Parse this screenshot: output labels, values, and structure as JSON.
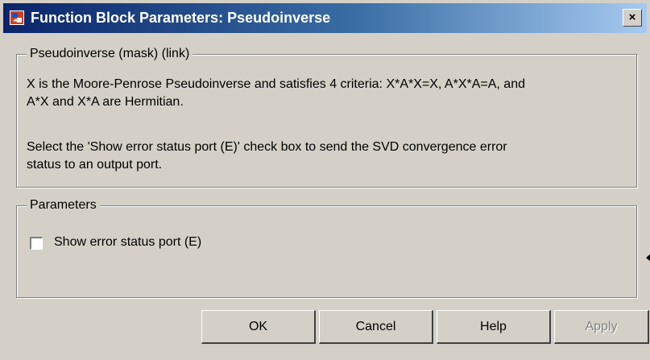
{
  "window": {
    "title": "Function Block Parameters: Pseudoinverse",
    "close_label": "×"
  },
  "description": {
    "group_title": "Pseudoinverse (mask) (link)",
    "line1": "X is the Moore-Penrose Pseudoinverse and satisfies 4 criteria: X*A*X=X, A*X*A=A, and",
    "line2": "A*X and X*A are Hermitian.",
    "line3": "Select the 'Show error status port (E)' check box to send the SVD convergence error",
    "line4": "status to an output port."
  },
  "parameters": {
    "group_title": "Parameters",
    "checkbox_label": "Show error status port (E)",
    "checkbox_checked": false
  },
  "buttons": {
    "ok": "OK",
    "cancel": "Cancel",
    "help": "Help",
    "apply": "Apply"
  },
  "colors": {
    "titlebar_start": "#0a246a",
    "titlebar_end": "#a6caf0",
    "dialog_bg": "#d4d0c8"
  },
  "icons": {
    "title": "simulink-block-icon",
    "close": "close-icon"
  }
}
